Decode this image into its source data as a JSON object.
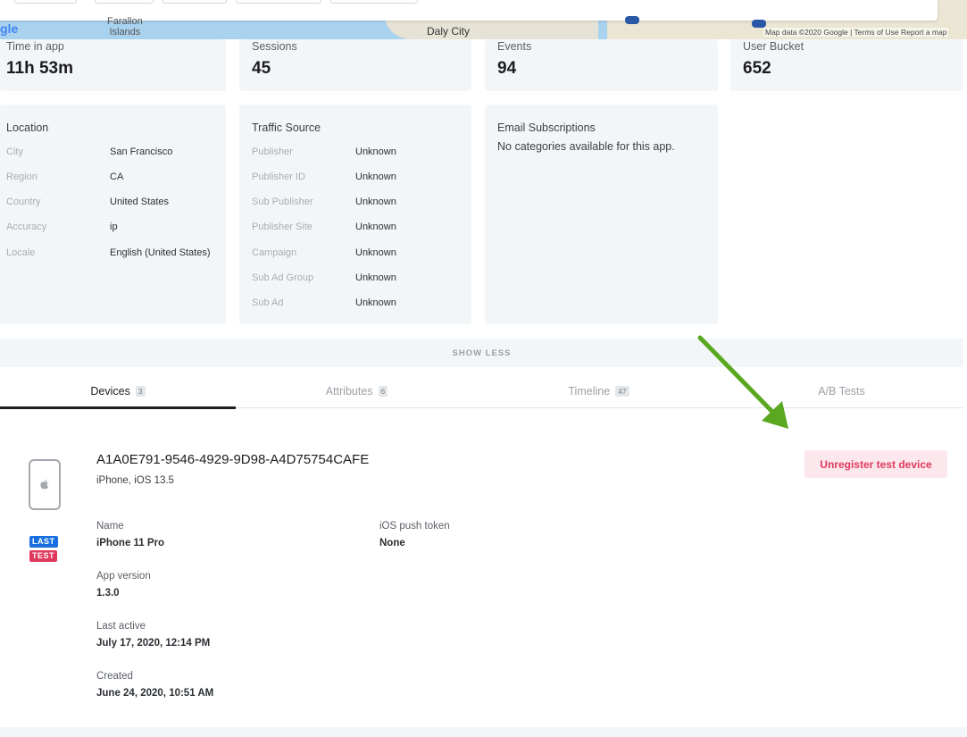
{
  "map": {
    "logo_fragment": "gle",
    "label_islands": "Farallon\nIslands",
    "label_daly_city": "Daly City",
    "attribution": "Map data ©2020 Google  |  Terms of Use   Report a map"
  },
  "stats": [
    {
      "label": "Time in app",
      "value": "11h 53m"
    },
    {
      "label": "Sessions",
      "value": "45"
    },
    {
      "label": "Events",
      "value": "94"
    },
    {
      "label": "User Bucket",
      "value": "652"
    }
  ],
  "location": {
    "title": "Location",
    "rows": [
      {
        "key": "City",
        "value": "San Francisco"
      },
      {
        "key": "Region",
        "value": "CA"
      },
      {
        "key": "Country",
        "value": "United States"
      },
      {
        "key": "Accuracy",
        "value": "ip"
      },
      {
        "key": "Locale",
        "value": "English (United States)"
      }
    ]
  },
  "traffic": {
    "title": "Traffic Source",
    "rows": [
      {
        "key": "Publisher",
        "value": "Unknown"
      },
      {
        "key": "Publisher ID",
        "value": "Unknown"
      },
      {
        "key": "Sub Publisher",
        "value": "Unknown"
      },
      {
        "key": "Publisher Site",
        "value": "Unknown"
      },
      {
        "key": "Campaign",
        "value": "Unknown"
      },
      {
        "key": "Sub Ad Group",
        "value": "Unknown"
      },
      {
        "key": "Sub Ad",
        "value": "Unknown"
      }
    ]
  },
  "email": {
    "title": "Email Subscriptions",
    "text": "No categories available for this app."
  },
  "show_less": "SHOW LESS",
  "tabs": [
    {
      "label": "Devices",
      "count": "3"
    },
    {
      "label": "Attributes",
      "count": "6"
    },
    {
      "label": "Timeline",
      "count": "47"
    },
    {
      "label": "A/B Tests",
      "count": ""
    }
  ],
  "device": {
    "id": "A1A0E791-9546-4929-9D98-A4D75754CAFE",
    "subtitle": "iPhone, iOS 13.5",
    "badge_last": "LAST",
    "badge_test": "TEST",
    "fields": {
      "name_label": "Name",
      "name_value": "iPhone 11 Pro",
      "push_label": "iOS push token",
      "push_value": "None",
      "appver_label": "App version",
      "appver_value": "1.3.0",
      "lastactive_label": "Last active",
      "lastactive_value": "July 17, 2020, 12:14 PM",
      "created_label": "Created",
      "created_value": "June 24, 2020, 10:51 AM"
    },
    "unregister_label": "Unregister test device"
  },
  "colors": {
    "accent_red": "#e0395e",
    "badge_blue": "#1a6fe0",
    "arrow_green": "#5aa820",
    "card_bg": "#f3f6f9"
  }
}
